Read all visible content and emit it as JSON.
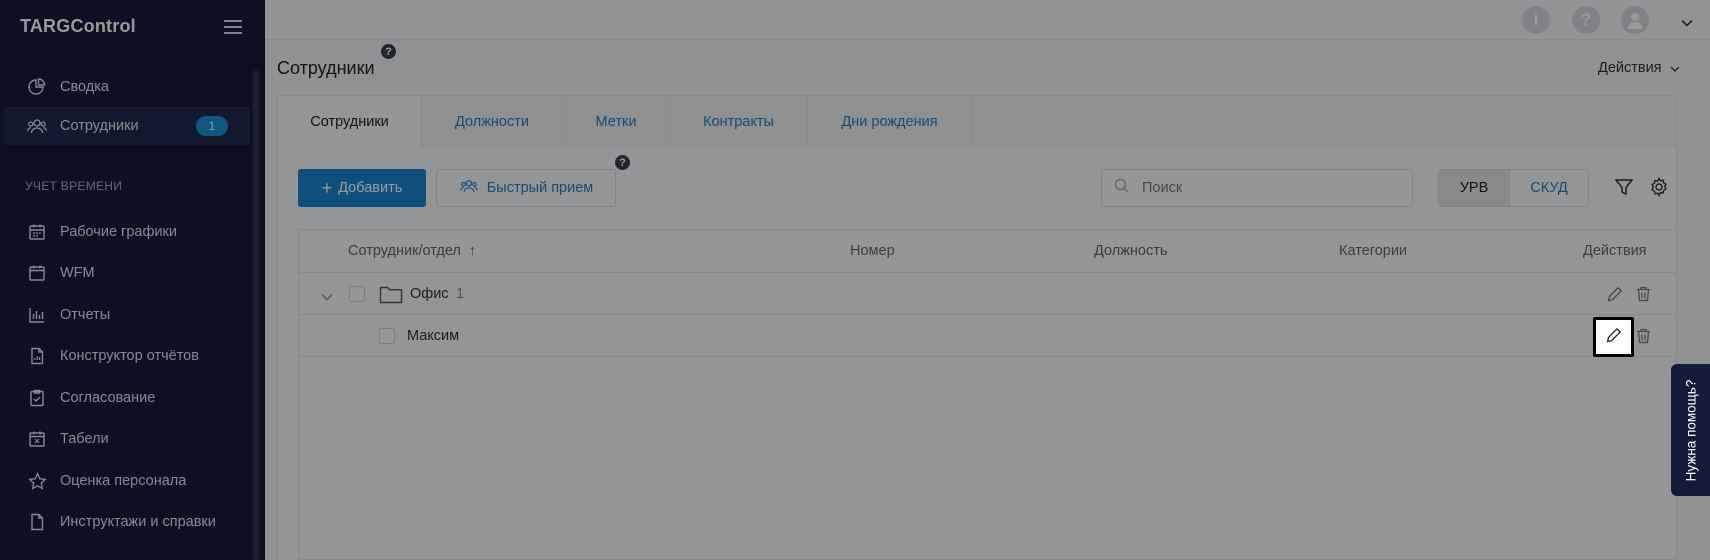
{
  "app": {
    "logo": "TARGControl"
  },
  "sidebar": {
    "items": [
      {
        "label": "Сводка",
        "icon": "pie-chart-icon"
      },
      {
        "label": "Сотрудники",
        "icon": "users-icon",
        "badge": "1"
      },
      {
        "label": "Рабочие графики",
        "icon": "calendar-icon"
      },
      {
        "label": "WFM",
        "icon": "calendar-blank-icon"
      },
      {
        "label": "Отчеты",
        "icon": "bar-chart-icon"
      },
      {
        "label": "Конструктор отчётов",
        "icon": "report-file-icon"
      },
      {
        "label": "Согласование",
        "icon": "clipboard-check-icon"
      },
      {
        "label": "Табели",
        "icon": "calendar-x-icon"
      },
      {
        "label": "Оценка персонала",
        "icon": "star-icon"
      },
      {
        "label": "Инструктажи и справки",
        "icon": "document-icon"
      }
    ],
    "section_label": "УЧЕТ ВРЕМЕНИ"
  },
  "topbar": {
    "icons": [
      "info-icon",
      "question-icon",
      "user-avatar-icon",
      "chevron-down-icon"
    ]
  },
  "page": {
    "title": "Сотрудники",
    "help_marker": "?",
    "actions_label": "Действия"
  },
  "tabs": [
    "Сотрудники",
    "Должности",
    "Метки",
    "Контракты",
    "Дни рождения"
  ],
  "toolbar": {
    "add_label": "Добавить",
    "quick_hire_label": "Быстрый прием",
    "quick_help_marker": "?",
    "search_placeholder": "Поиск",
    "segment_urv": "УРВ",
    "segment_skud": "СКУД"
  },
  "table": {
    "columns": [
      "Сотрудник/отдел",
      "Номер",
      "Должность",
      "Категории",
      "Действия"
    ],
    "sort_indicator": "↑",
    "rows": [
      {
        "name": "Офис",
        "count": "1",
        "type": "folder"
      },
      {
        "name": "Максим",
        "type": "employee"
      }
    ]
  },
  "help_tab": {
    "label": "Нужна помощь?"
  },
  "colors": {
    "sidebar": "#141c3a",
    "accent": "#1a85cf",
    "link": "#2080c8"
  }
}
